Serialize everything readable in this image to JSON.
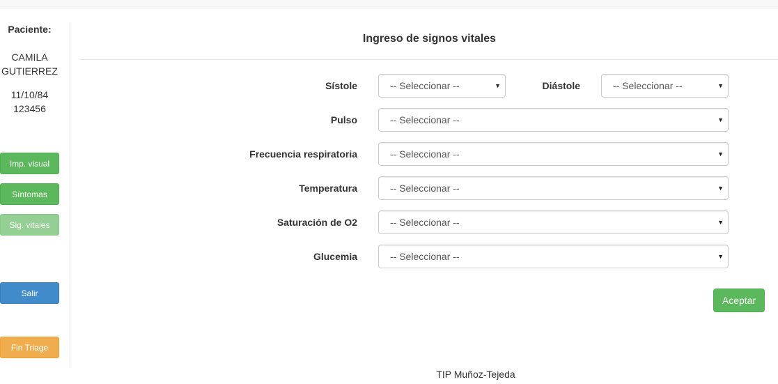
{
  "patient": {
    "heading": "Paciente:",
    "name": "CAMILA GUTIERREZ",
    "birthdate": "11/10/84",
    "id": "123456"
  },
  "sidebar": {
    "buttons": [
      {
        "label": "Imp. visual"
      },
      {
        "label": "Síntomas"
      },
      {
        "label": "Sig. vitales"
      },
      {
        "label": "Salir"
      },
      {
        "label": "Fin Triage"
      }
    ]
  },
  "form": {
    "title": "Ingreso de signos vitales",
    "fields": {
      "sistole": {
        "label": "Sístole",
        "value": "-- Seleccionar --"
      },
      "diastole": {
        "label": "Diástole",
        "value": "-- Seleccionar --"
      },
      "pulso": {
        "label": "Pulso",
        "value": "-- Seleccionar --"
      },
      "frecuencia": {
        "label": "Frecuencia respiratoria",
        "value": "-- Seleccionar --"
      },
      "temperatura": {
        "label": "Temperatura",
        "value": "-- Seleccionar --"
      },
      "saturacion": {
        "label": "Saturación de O2",
        "value": "-- Seleccionar --"
      },
      "glucemia": {
        "label": "Glucemia",
        "value": "-- Seleccionar --"
      }
    },
    "submit_label": "Aceptar"
  },
  "footer": {
    "text": "TIP Muñoz-Tejeda"
  },
  "colors": {
    "success": "#5cb85c",
    "primary": "#428bca",
    "warning": "#f0ad4e"
  },
  "icons": {
    "select_caret": "caret-down-icon"
  }
}
